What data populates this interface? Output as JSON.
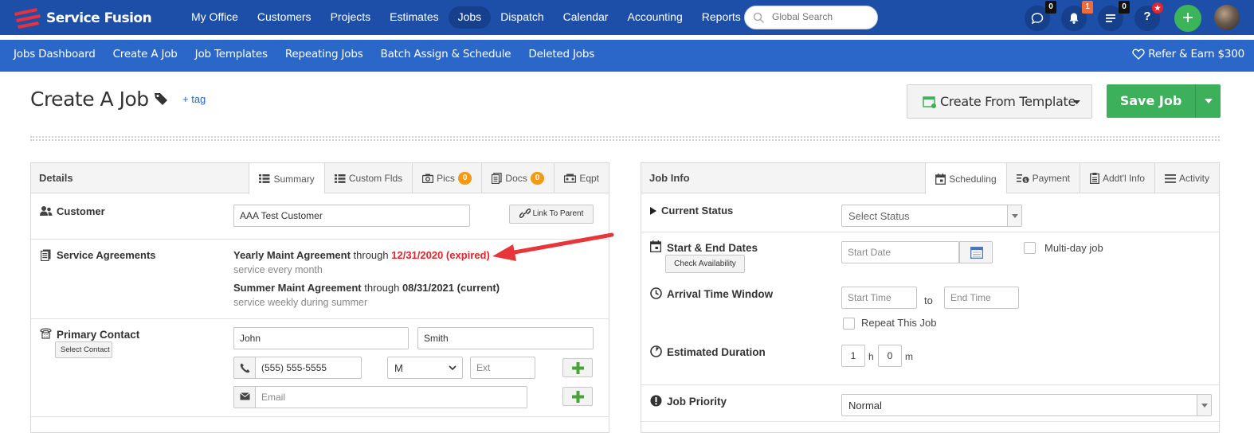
{
  "app": {
    "name": "Service Fusion",
    "brand_color": "#1d4fa8",
    "accent_color": "#2a67c9",
    "success_color": "#3cb05a"
  },
  "nav": {
    "items": [
      "My Office",
      "Customers",
      "Projects",
      "Estimates",
      "Jobs",
      "Dispatch",
      "Calendar",
      "Accounting",
      "Reports"
    ],
    "active": "Jobs"
  },
  "search": {
    "placeholder": "Global Search"
  },
  "header_icons": {
    "chat": {
      "icon": "chat-icon",
      "count": "0"
    },
    "notifications": {
      "icon": "bell-icon",
      "count": "1"
    },
    "tasks": {
      "icon": "list-icon",
      "count": "0"
    },
    "help": {
      "icon": "question-icon",
      "badge": "star"
    },
    "add": {
      "icon": "plus-icon",
      "label": "+"
    }
  },
  "subnav": {
    "items": [
      "Jobs Dashboard",
      "Create A Job",
      "Job Templates",
      "Repeating Jobs",
      "Batch Assign & Schedule",
      "Deleted Jobs"
    ],
    "active": "Create A Job",
    "refer": "Refer & Earn $300"
  },
  "page": {
    "title": "Create A Job",
    "tag_link": "+ tag",
    "template_button": "Create From Template",
    "save_button": "Save Job"
  },
  "details": {
    "title": "Details",
    "tabs": [
      {
        "label": "Summary",
        "icon": "list-icon"
      },
      {
        "label": "Custom Flds",
        "icon": "list-icon"
      },
      {
        "label": "Pics",
        "icon": "camera-icon",
        "count": "0"
      },
      {
        "label": "Docs",
        "icon": "docs-icon",
        "count": "0"
      },
      {
        "label": "Eqpt",
        "icon": "equipment-icon"
      }
    ],
    "customer": {
      "label": "Customer",
      "value": "AAA Test Customer",
      "link_button": "Link To Parent"
    },
    "agreements": {
      "label": "Service Agreements",
      "items": [
        {
          "name": "Yearly Maint Agreement",
          "through": "through",
          "date": "12/31/2020 (expired)",
          "note": "service every month",
          "expired": true
        },
        {
          "name": "Summer Maint Agreement",
          "through": "through",
          "date": "08/31/2021 (current)",
          "note": "service weekly during summer",
          "expired": false
        }
      ]
    },
    "primary_contact": {
      "label": "Primary Contact",
      "select_button": "Select Contact",
      "first_name": "John",
      "last_name": "Smith",
      "phone": "(555) 555-5555",
      "phone_type": "M",
      "ext_placeholder": "Ext",
      "email_placeholder": "Email"
    }
  },
  "job_info": {
    "title": "Job Info",
    "tabs": [
      {
        "label": "Scheduling",
        "icon": "calendar-icon"
      },
      {
        "label": "Payment",
        "icon": "payment-icon"
      },
      {
        "label": "Addt'l Info",
        "icon": "clipboard-icon"
      },
      {
        "label": "Activity",
        "icon": "list-icon"
      }
    ],
    "current_status": {
      "label": "Current Status",
      "placeholder": "Select Status"
    },
    "dates": {
      "label": "Start & End Dates",
      "check_button": "Check Availability",
      "start_placeholder": "Start Date",
      "multiday_label": "Multi-day job"
    },
    "arrival": {
      "label": "Arrival Time Window",
      "start_placeholder": "Start Time",
      "to": "to",
      "end_placeholder": "End Time",
      "repeat_label": "Repeat This Job"
    },
    "duration": {
      "label": "Estimated Duration",
      "hours": "1",
      "h": "h",
      "minutes": "0",
      "m": "m"
    },
    "priority": {
      "label": "Job Priority",
      "value": "Normal"
    }
  }
}
